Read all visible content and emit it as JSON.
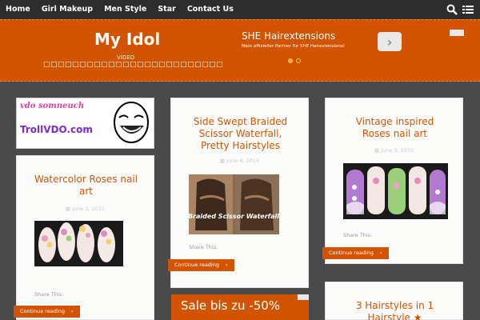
{
  "nav": {
    "items": [
      "Home",
      "Girl Makeup",
      "Men Style",
      "Star",
      "Contact Us"
    ]
  },
  "header": {
    "title": "My Idol",
    "tagline": "VIDEO",
    "boxes": "□□□□□□□□□□□□□□□□□□□□□□□□□"
  },
  "top_ad": {
    "title": "SHE Hairextensions",
    "subtitle": "Mein offizieller Partner für SHE Hairextensions!",
    "arrow": "›"
  },
  "sidebar_ad": {
    "line1": "vdo somneuch",
    "line2": "TrollVDO.com"
  },
  "posts": [
    {
      "title": "Watercolor Roses nail art",
      "date": "June 3, 2015",
      "share": "Share This:",
      "button": "Continue reading"
    },
    {
      "title": "Side Swept Braided Scissor Waterfall, Pretty Hairstyles",
      "date": "June 4, 2015",
      "share": "Share This:",
      "button": "Continue reading",
      "image_caption": "Braided Scissor Waterfall"
    },
    {
      "title": "Vintage inspired Roses nail art",
      "date": "June 3, 2015",
      "share": "Share This:",
      "button": "Continue reading"
    },
    {
      "title": "3 Hairstyles in 1 Hairstyle ★"
    }
  ],
  "sale_ad": {
    "text": "Sale bis zu -50%"
  },
  "colors": {
    "accent": "#d35400",
    "background": "#4a4a4a",
    "nav": "#2d2d2d",
    "card": "#fbfbfa"
  }
}
